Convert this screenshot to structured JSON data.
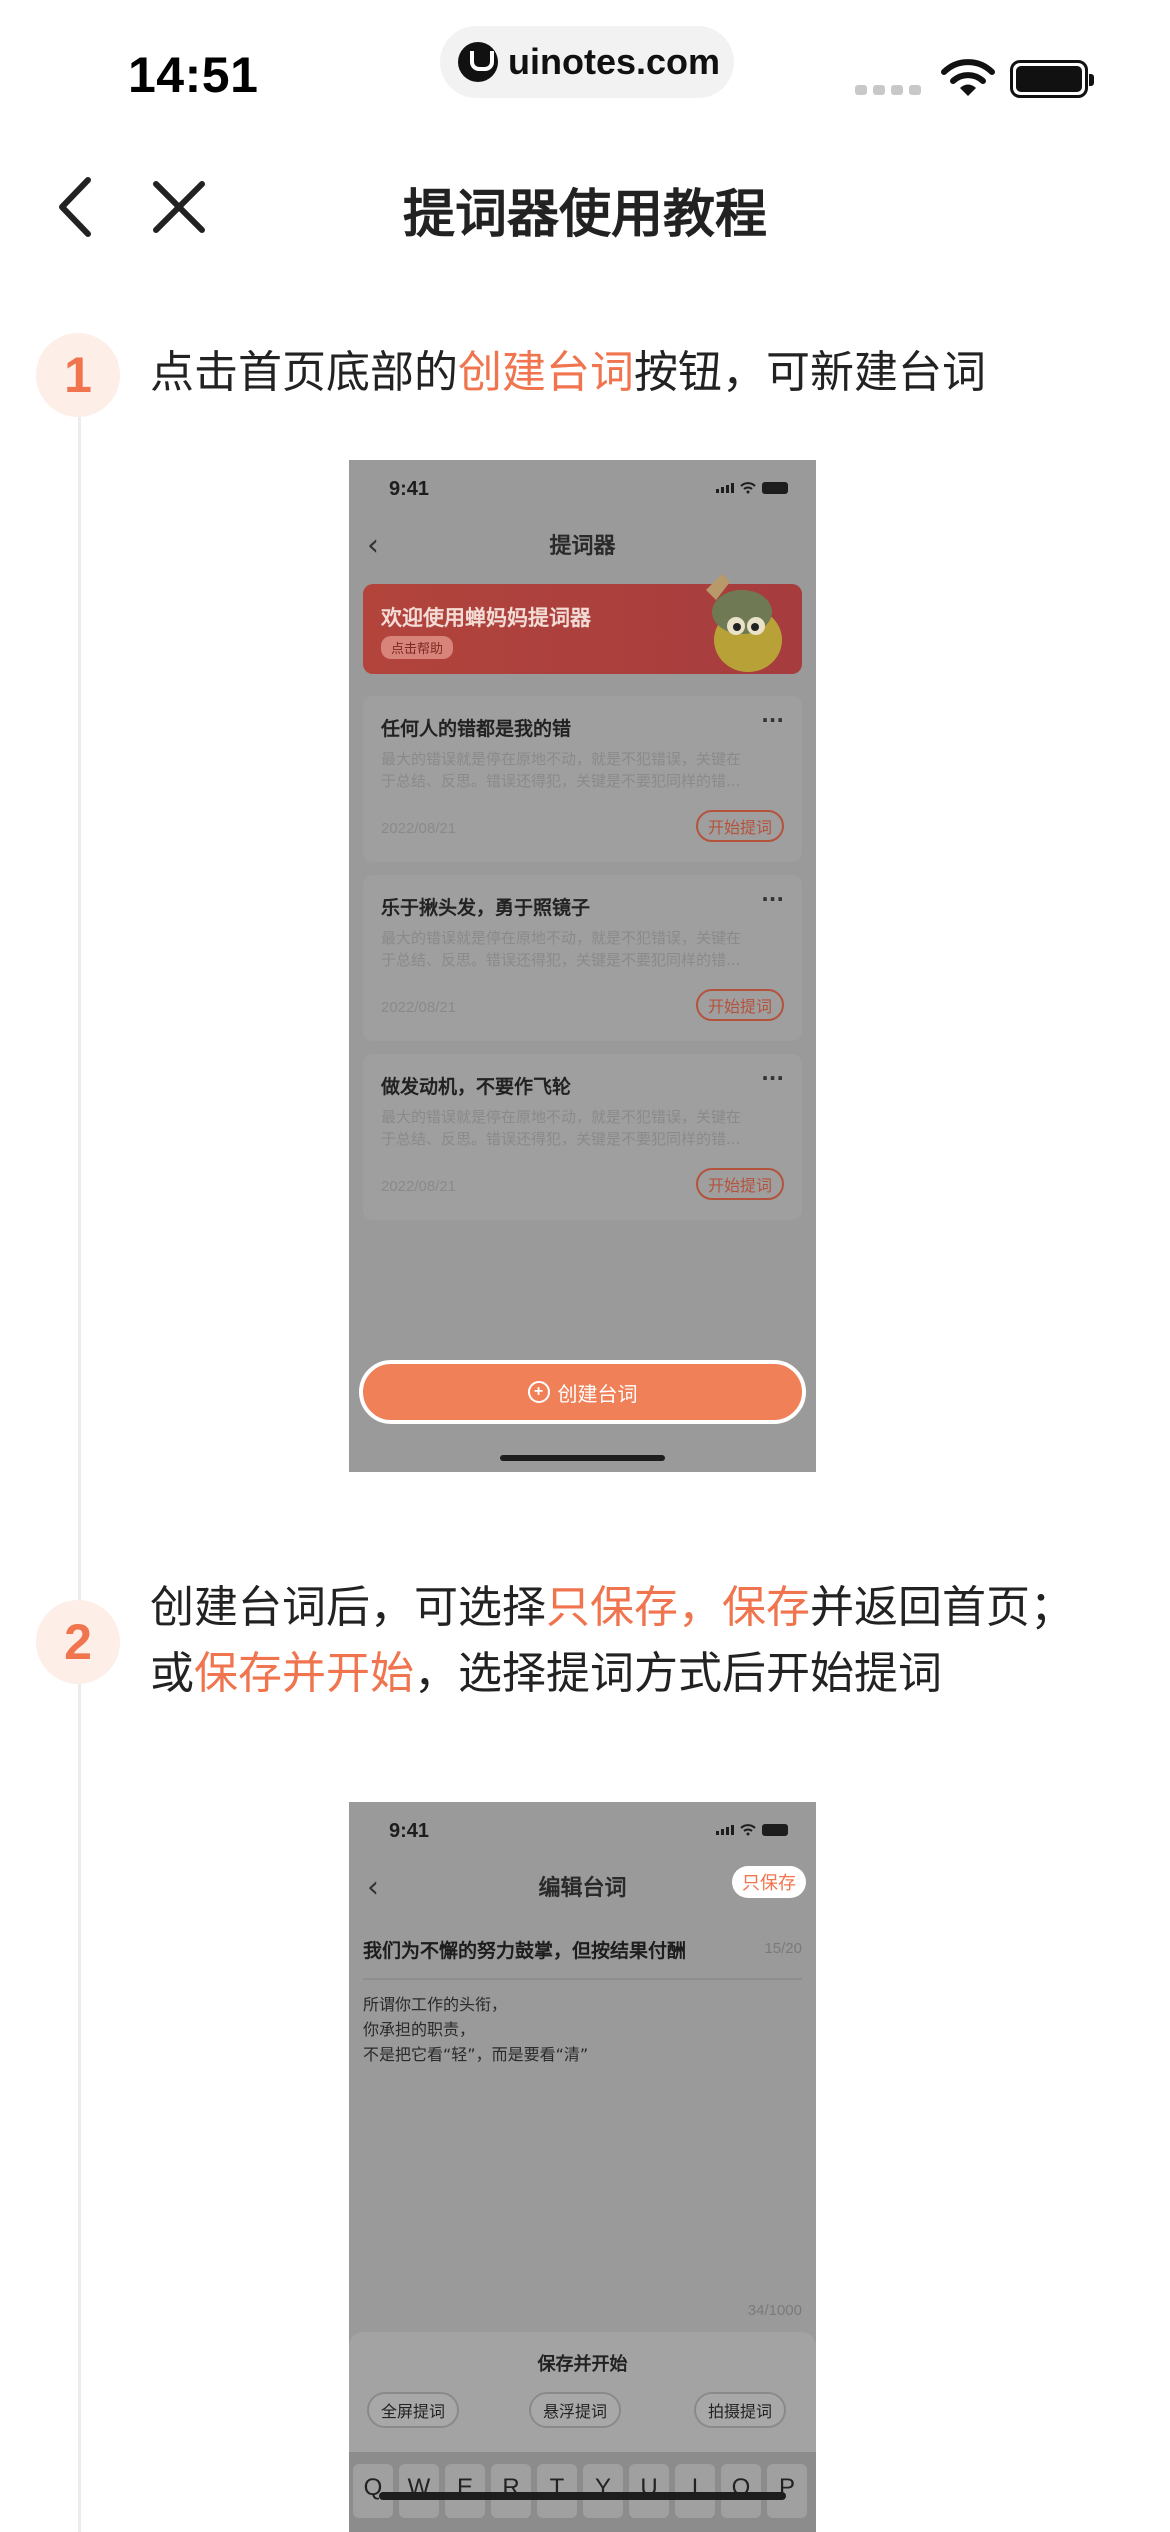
{
  "status_bar": {
    "time": "14:51",
    "url": "uinotes.com"
  },
  "nav": {
    "title": "提词器使用教程"
  },
  "steps": [
    {
      "number": "1",
      "text_before": "点击首页底部的",
      "highlight": "创建台词",
      "text_after": "按钮，可新建台词"
    },
    {
      "number": "2",
      "line1_before": "创建台词后，可选择",
      "line1_highlight": "只保存，保存",
      "line1_after": "并返回首页；",
      "line2_before": "或",
      "line2_highlight": "保存并开始",
      "line2_after": "，选择提词方式后开始提词"
    }
  ],
  "mock1": {
    "time": "9:41",
    "title": "提词器",
    "banner_title": "欢迎使用蝉妈妈提词器",
    "banner_button": "点击帮助",
    "cards": [
      {
        "title": "任何人的错都是我的错",
        "desc_line1": "最大的错误就是停在原地不动，就是不犯错误，关键在",
        "desc_line2": "于总结、反思。错误还得犯，关键是不要犯同样的错...",
        "date": "2022/08/21",
        "button": "开始提词"
      },
      {
        "title": "乐于揪头发，勇于照镜子",
        "desc_line1": "最大的错误就是停在原地不动，就是不犯错误，关键在",
        "desc_line2": "于总结、反思。错误还得犯，关键是不要犯同样的错...",
        "date": "2022/08/21",
        "button": "开始提词"
      },
      {
        "title": "做发动机，不要作飞轮",
        "desc_line1": "最大的错误就是停在原地不动，就是不犯错误，关键在",
        "desc_line2": "于总结、反思。错误还得犯，关键是不要犯同样的错...",
        "date": "2022/08/21",
        "button": "开始提词"
      }
    ],
    "create_button": "创建台词"
  },
  "mock2": {
    "time": "9:41",
    "title": "编辑台词",
    "save_only": "只保存",
    "headline": "我们为不懈的努力鼓掌，但按结果付酬",
    "headline_count": "15/20",
    "body_lines": [
      "所谓你工作的头衔，",
      "你承担的职责，",
      "不是把它看“轻”，而是要看“清”"
    ],
    "body_count": "34/1000",
    "sheet_title": "保存并开始",
    "options": [
      "全屏提词",
      "悬浮提词",
      "拍摄提词"
    ],
    "keys": [
      "Q",
      "W",
      "E",
      "R",
      "T",
      "Y",
      "U",
      "I",
      "O",
      "P"
    ]
  },
  "colors": {
    "accent": "#f0744e",
    "mock_overlay": "#9a9a9a"
  }
}
